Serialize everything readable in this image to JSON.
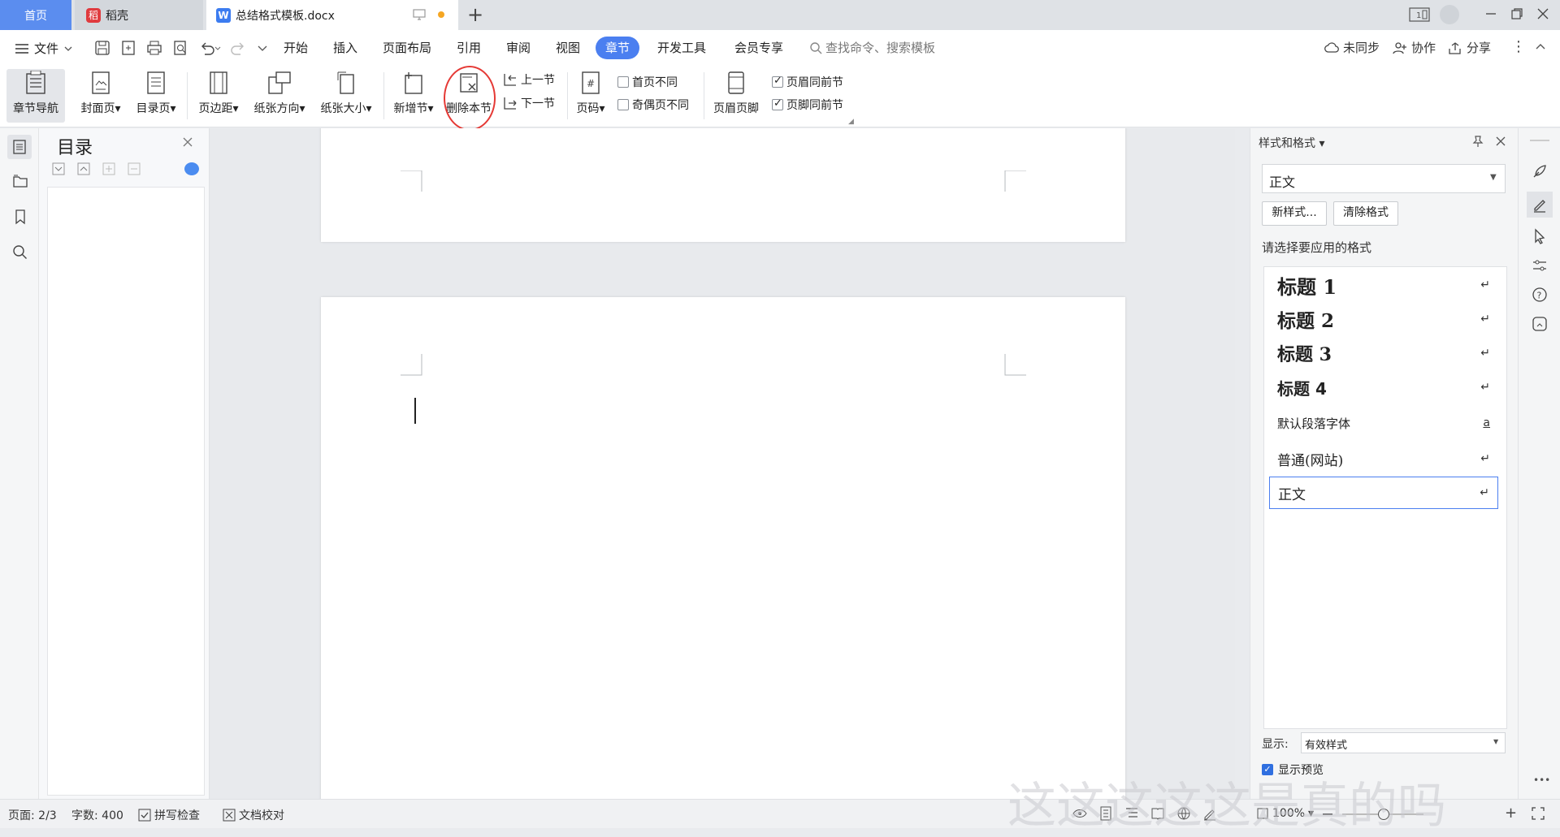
{
  "tabs": {
    "home": "首页",
    "daoke": "稻壳",
    "doc": "总结格式模板.docx",
    "add": "+"
  },
  "menubar": {
    "file": "文件",
    "items": [
      "开始",
      "插入",
      "页面布局",
      "引用",
      "审阅",
      "视图",
      "章节",
      "开发工具",
      "会员专享"
    ],
    "search_placeholder": "查找命令、搜索模板",
    "sync": "未同步",
    "collab": "协作",
    "share": "分享"
  },
  "ribbon": {
    "chapter_nav": "章节导航",
    "cover": "封面页",
    "toc_page": "目录页",
    "margins": "页边距",
    "orientation": "纸张方向",
    "paper_size": "纸张大小",
    "add_section": "新增节",
    "delete_section": "删除本节",
    "prev_section": "上一节",
    "next_section": "下一节",
    "page_number": "页码",
    "first_page_diff": "首页不同",
    "odd_even_diff": "奇偶页不同",
    "header_footer": "页眉页脚",
    "header_same": "页眉同前节",
    "footer_same": "页脚同前节"
  },
  "checks": {
    "first_page_diff": false,
    "odd_even_diff": false,
    "header_same": true,
    "footer_same": true
  },
  "toc_panel": {
    "title": "目录"
  },
  "style_panel": {
    "title": "样式和格式",
    "current_style": "正文",
    "new_style": "新样式...",
    "clear_format": "清除格式",
    "choose_label": "请选择要应用的格式",
    "styles": [
      {
        "name": "标题  1",
        "mark": "↵"
      },
      {
        "name": "标题  2",
        "mark": "↵"
      },
      {
        "name": "标题  3",
        "mark": "↵"
      },
      {
        "name": "标题  4",
        "mark": "↵"
      },
      {
        "name": "默认段落字体",
        "mark": "a"
      },
      {
        "name": "普通(网站)",
        "mark": "↵"
      },
      {
        "name": "正文",
        "mark": "↵"
      }
    ],
    "show_label": "显示:",
    "show_value": "有效样式",
    "preview_label": "显示预览",
    "preview_checked": true
  },
  "statusbar": {
    "page": "页面: 2/3",
    "words": "字数: 400",
    "spell": "拼写检查",
    "proof": "文档校对",
    "zoom": "100%"
  },
  "watermark": "这这这这这是真的吗",
  "colors": {
    "accent": "#4b7ff0",
    "home_tab": "#5b8def",
    "annotation": "#e53935"
  }
}
